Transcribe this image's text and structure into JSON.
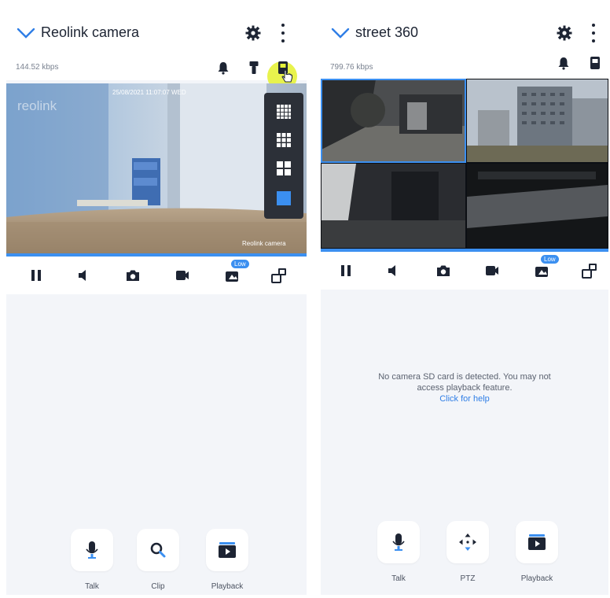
{
  "left_screen": {
    "title": "Reolink camera",
    "bitrate": "144.52 kbps",
    "watermark": "reolink",
    "osd_timestamp": "25/08/2021 11:07:07 WED",
    "osd_camera_name": "Reolink camera",
    "grid_menu": [
      "grid-4x4",
      "grid-3x3",
      "grid-2x2",
      "grid-1x1"
    ],
    "toolbar": [
      "pause",
      "mute",
      "snapshot",
      "record",
      "stream-quality-low",
      "multi-view"
    ],
    "low_label": "Low",
    "actions": [
      {
        "label": "Talk",
        "icon": "microphone-icon"
      },
      {
        "label": "Clip",
        "icon": "search-icon"
      },
      {
        "label": "Playback",
        "icon": "playback-icon"
      }
    ]
  },
  "right_screen": {
    "title": "street 360",
    "bitrate": "799.76 kbps",
    "toolbar": [
      "pause",
      "mute",
      "snapshot",
      "record",
      "stream-quality-low",
      "multi-view"
    ],
    "low_label": "Low",
    "notice_line1": "No camera SD card is detected. You may not",
    "notice_line2": "access playback feature.",
    "help_link": "Click for help",
    "actions": [
      {
        "label": "Talk",
        "icon": "microphone-icon"
      },
      {
        "label": "PTZ",
        "icon": "ptz-arrows-icon"
      },
      {
        "label": "Playback",
        "icon": "playback-icon"
      }
    ]
  },
  "colors": {
    "accent": "#3b8ff0",
    "text_dark": "#1d2433",
    "background": "#f3f5f9",
    "highlight": "#e5f23a"
  }
}
